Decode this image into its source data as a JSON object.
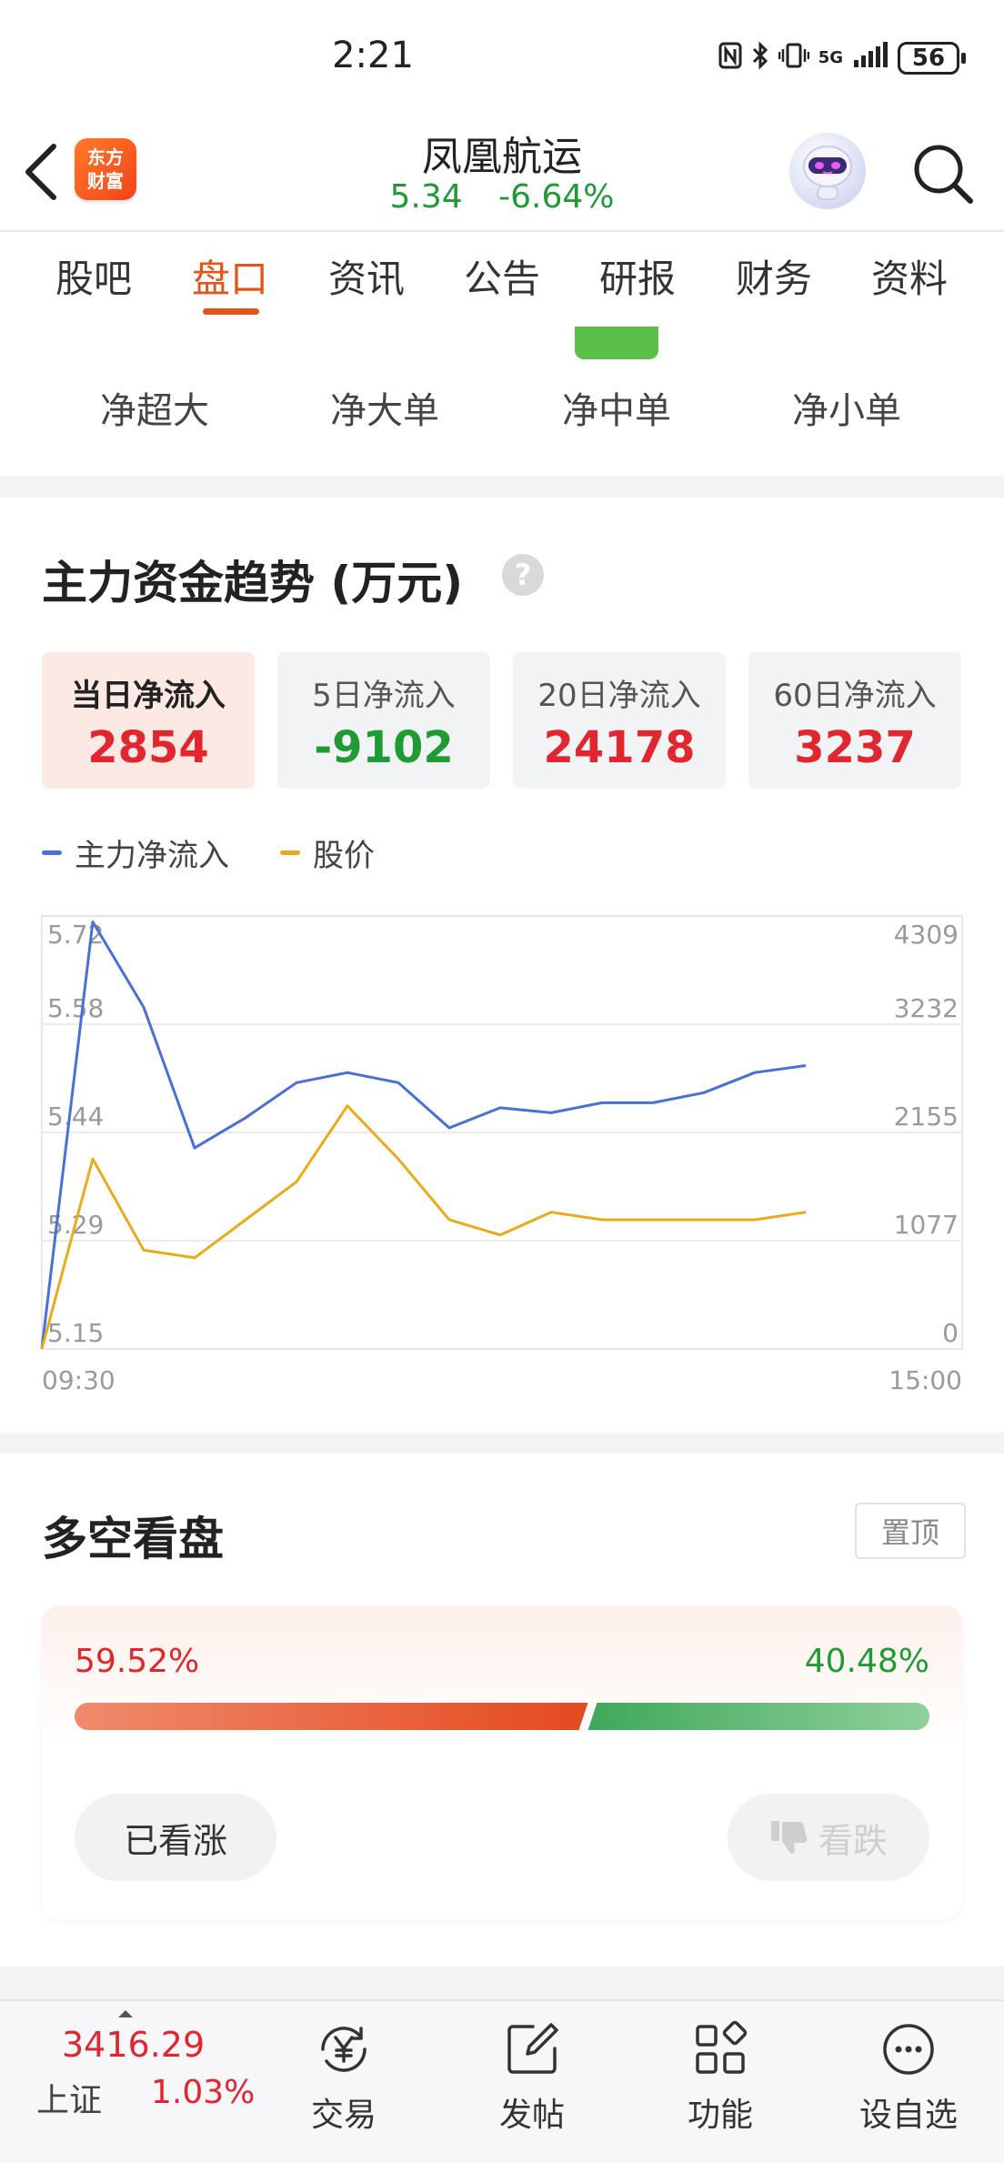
{
  "status_bar": {
    "time": "2:21",
    "network": "5G",
    "battery": "56"
  },
  "header": {
    "logo_line1": "东方",
    "logo_line2": "财富",
    "stock_name": "凤凰航运",
    "price": "5.34",
    "change_pct": "-6.64%"
  },
  "tabs": [
    {
      "label": "股吧"
    },
    {
      "label": "盘口"
    },
    {
      "label": "资讯"
    },
    {
      "label": "公告"
    },
    {
      "label": "研报"
    },
    {
      "label": "财务"
    },
    {
      "label": "资料"
    }
  ],
  "active_tab": "盘口",
  "subtabs": [
    {
      "label": "净超大"
    },
    {
      "label": "净大单"
    },
    {
      "label": "净中单"
    },
    {
      "label": "净小单"
    }
  ],
  "fund_trend": {
    "title": "主力资金趋势 (万元)",
    "help": "?",
    "periods": [
      {
        "label": "当日净流入",
        "value": "2854",
        "tone": "red",
        "active": true
      },
      {
        "label": "5日净流入",
        "value": "-9102",
        "tone": "green",
        "active": false
      },
      {
        "label": "20日净流入",
        "value": "24178",
        "tone": "red",
        "active": false
      },
      {
        "label": "60日净流入",
        "value": "3237",
        "tone": "red",
        "active": false
      }
    ]
  },
  "colors": {
    "accent": "#e0561b",
    "up": "#e0262e",
    "down": "#1f9a35",
    "flow_line": "#4a6fd6",
    "price_line": "#e9ab1a"
  },
  "chart_data": {
    "type": "line",
    "legend": [
      "主力净流入",
      "股价"
    ],
    "x_labels": [
      "09:30",
      "15:00"
    ],
    "x": [
      "09:30",
      "09:45",
      "10:00",
      "10:15",
      "10:30",
      "10:45",
      "11:00",
      "11:15",
      "11:30",
      "13:15",
      "13:30",
      "13:45",
      "14:00",
      "14:15",
      "14:30",
      "14:45"
    ],
    "left_axis": {
      "ticks": [
        "5.72",
        "5.58",
        "5.44",
        "5.29",
        "5.15"
      ],
      "range": [
        5.15,
        5.72
      ]
    },
    "right_axis": {
      "ticks": [
        "4309",
        "3232",
        "2155",
        "1077",
        "0"
      ],
      "range": [
        0,
        4309
      ]
    },
    "series": [
      {
        "name": "主力净流入",
        "axis": "right",
        "values": [
          0,
          4250,
          3400,
          2000,
          2300,
          2650,
          2750,
          2650,
          2200,
          2400,
          2350,
          2450,
          2450,
          2550,
          2750,
          2820
        ]
      },
      {
        "name": "股价",
        "axis": "left",
        "values": [
          5.15,
          5.4,
          5.28,
          5.27,
          5.32,
          5.37,
          5.47,
          5.4,
          5.32,
          5.3,
          5.33,
          5.32,
          5.32,
          5.32,
          5.32,
          5.33
        ]
      }
    ]
  },
  "bull_bear": {
    "title": "多空看盘",
    "pin_label": "置顶",
    "bull_pct": "59.52%",
    "bear_pct": "40.48%",
    "bull_fraction": 0.5952,
    "voted_up_label": "已看涨",
    "down_label": "看跌"
  },
  "bottom_nav": {
    "index_value": "3416.29",
    "index_name": "上证",
    "index_change": "1.03%",
    "items": [
      {
        "label": "交易",
        "icon": "yen-refresh-icon"
      },
      {
        "label": "发帖",
        "icon": "edit-icon"
      },
      {
        "label": "功能",
        "icon": "apps-grid-icon"
      },
      {
        "label": "设自选",
        "icon": "more-dots-icon"
      }
    ]
  }
}
